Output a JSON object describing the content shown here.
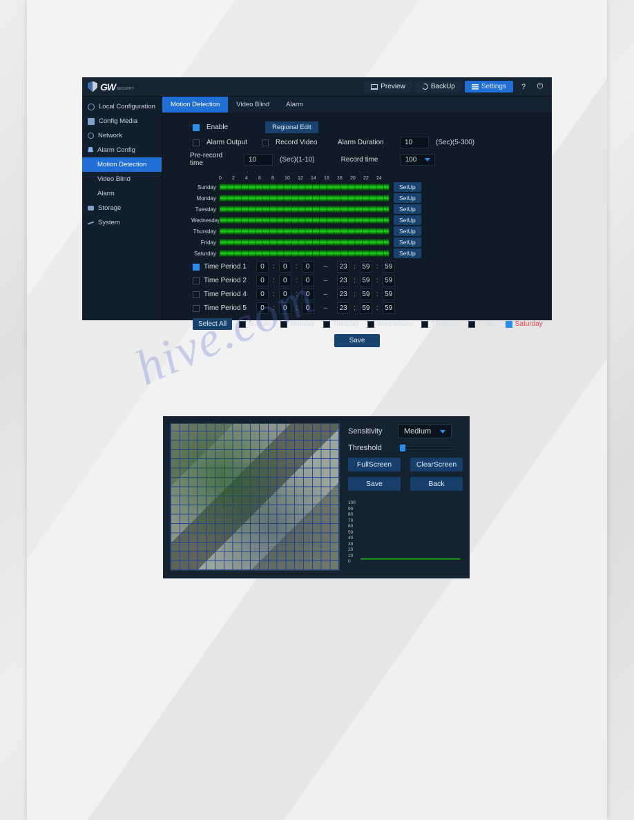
{
  "topbar": {
    "logo_text": "GW",
    "logo_sub": "SECURITY",
    "preview": "Preview",
    "backup": "BackUp",
    "settings": "Settings"
  },
  "sidebar": {
    "items": [
      {
        "label": "Local Configuration"
      },
      {
        "label": "Config Media"
      },
      {
        "label": "Network"
      },
      {
        "label": "Alarm Config"
      },
      {
        "label": "Motion Detection"
      },
      {
        "label": "Video Blind"
      },
      {
        "label": "Alarm"
      },
      {
        "label": "Storage"
      },
      {
        "label": "System"
      }
    ]
  },
  "tabs": {
    "motion": "Motion Detection",
    "video_blind": "Video Blind",
    "alarm": "Alarm"
  },
  "form": {
    "enable": "Enable",
    "regional_edit": "Regional Edit",
    "alarm_output": "Alarm Output",
    "record_video": "Record Video",
    "alarm_duration": "Alarm Duration",
    "alarm_duration_val": "10",
    "alarm_duration_hint": "(Sec)(5-300)",
    "prerecord": "Pre-record time",
    "prerecord_val": "10",
    "prerecord_hint": "(Sec)(1-10)",
    "record_time": "Record time",
    "record_time_val": "100"
  },
  "schedule": {
    "hours": [
      "0",
      "2",
      "4",
      "6",
      "8",
      "10",
      "12",
      "14",
      "16",
      "18",
      "20",
      "22",
      "24"
    ],
    "days": [
      "Sunday",
      "Monday",
      "Tuesday",
      "Wednesday",
      "Thursday",
      "Friday",
      "Saturday"
    ],
    "setup": "SetUp"
  },
  "periods": {
    "rows": [
      {
        "label": "Time Period 1",
        "on": true,
        "h1": "0",
        "m1": "0",
        "s1": "0",
        "h2": "23",
        "m2": "59",
        "s2": "59"
      },
      {
        "label": "Time Period 2",
        "on": false,
        "h1": "0",
        "m1": "0",
        "s1": "0",
        "h2": "23",
        "m2": "59",
        "s2": "59"
      },
      {
        "label": "Time Period 4",
        "on": false,
        "h1": "0",
        "m1": "0",
        "s1": "0",
        "h2": "23",
        "m2": "59",
        "s2": "59"
      },
      {
        "label": "Time Period 5",
        "on": false,
        "h1": "0",
        "m1": "0",
        "s1": "0",
        "h2": "23",
        "m2": "59",
        "s2": "59"
      }
    ]
  },
  "days_row": {
    "select_all": "Select All",
    "days": [
      "Sunday",
      "Monday",
      "Tuesday",
      "Wednesday",
      "Thursday",
      "Friday",
      "Saturday"
    ],
    "checked_index": 6
  },
  "save": "Save",
  "region": {
    "sensitivity": "Sensitivity",
    "sensitivity_val": "Medium",
    "threshold": "Threshold",
    "fullscreen": "FullScreen",
    "clearscreen": "ClearScreen",
    "save": "Save",
    "back": "Back",
    "scale": [
      "100",
      "90",
      "80",
      "70",
      "60",
      "50",
      "40",
      "30",
      "20",
      "10",
      "0"
    ]
  },
  "watermark": "hive.com"
}
